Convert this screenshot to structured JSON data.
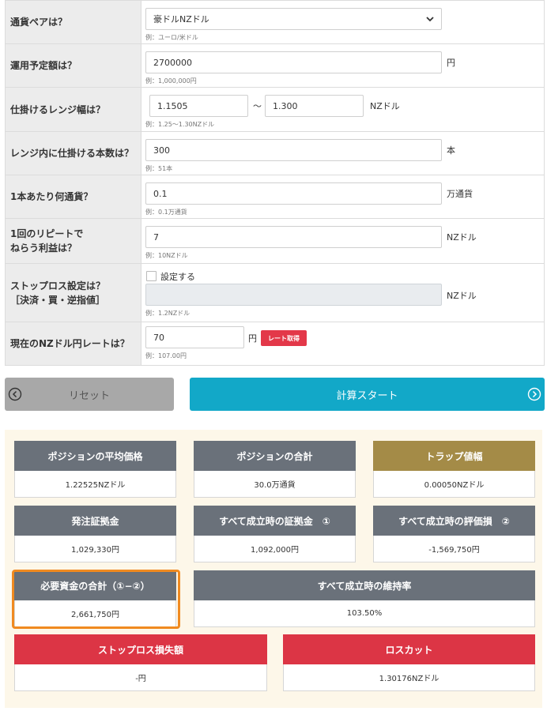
{
  "form": {
    "pair": {
      "label": "通貨ペアは？",
      "value": "豪ドルNZドル",
      "hint": "例：ユーロ/米ドル"
    },
    "amount": {
      "label": "運用予定額は？",
      "value": "2700000",
      "unit": "円",
      "hint": "例：1,000,000円"
    },
    "range": {
      "label": "仕掛けるレンジ幅は？",
      "low": "1.1505",
      "tilde": "～",
      "high": "1.300",
      "unit": "NZドル",
      "hint": "例：1.25～1.30NZドル"
    },
    "count": {
      "label": "レンジ内に仕掛ける本数は？",
      "value": "300",
      "unit": "本",
      "hint": "例：51本"
    },
    "lot": {
      "label": "1本あたり何通貨？",
      "value": "0.1",
      "unit": "万通貨",
      "hint": "例：0.1万通貨"
    },
    "profit": {
      "label": "1回のリピートで\nねらう利益は？",
      "value": "7",
      "unit": "NZドル",
      "hint": "例：10NZドル"
    },
    "stoploss": {
      "label": "ストップロス設定は？\n［決済・買・逆指値］",
      "checkbox_label": "設定する",
      "value": "",
      "unit": "NZドル",
      "hint": "例：1.2NZドル"
    },
    "rate": {
      "label": "現在のNZドル円レートは？",
      "value": "70",
      "unit": "円",
      "button": "レート取得",
      "hint": "例：107.00円"
    }
  },
  "buttons": {
    "reset": "リセット",
    "calc": "計算スタート"
  },
  "results": {
    "avg_price": {
      "title": "ポジションの平均価格",
      "value": "1.22525NZドル"
    },
    "total_pos": {
      "title": "ポジションの合計",
      "value": "30.0万通貨"
    },
    "trap_width": {
      "title": "トラップ値幅",
      "value": "0.00050NZドル"
    },
    "order_margin": {
      "title": "発注証拠金",
      "value": "1,029,330円"
    },
    "margin_all": {
      "title": "すべて成立時の証拠金　①",
      "value": "1,092,000円"
    },
    "loss_all": {
      "title": "すべて成立時の評価損　②",
      "value": "-1,569,750円"
    },
    "required_total": {
      "title": "必要資金の合計（①−②）",
      "value": "2,661,750円"
    },
    "maint_rate": {
      "title": "すべて成立時の維持率",
      "value": "103.50%"
    },
    "stoploss_amount": {
      "title": "ストップロス損失額",
      "value": "-円"
    },
    "loss_cut": {
      "title": "ロスカット",
      "value": "1.30176NZドル"
    }
  },
  "colors": {
    "header_gray": "#6a717a",
    "header_gold": "#a48b47",
    "header_red": "#dc3545",
    "calc_button": "#12a8c8",
    "highlight": "#f08a20"
  }
}
